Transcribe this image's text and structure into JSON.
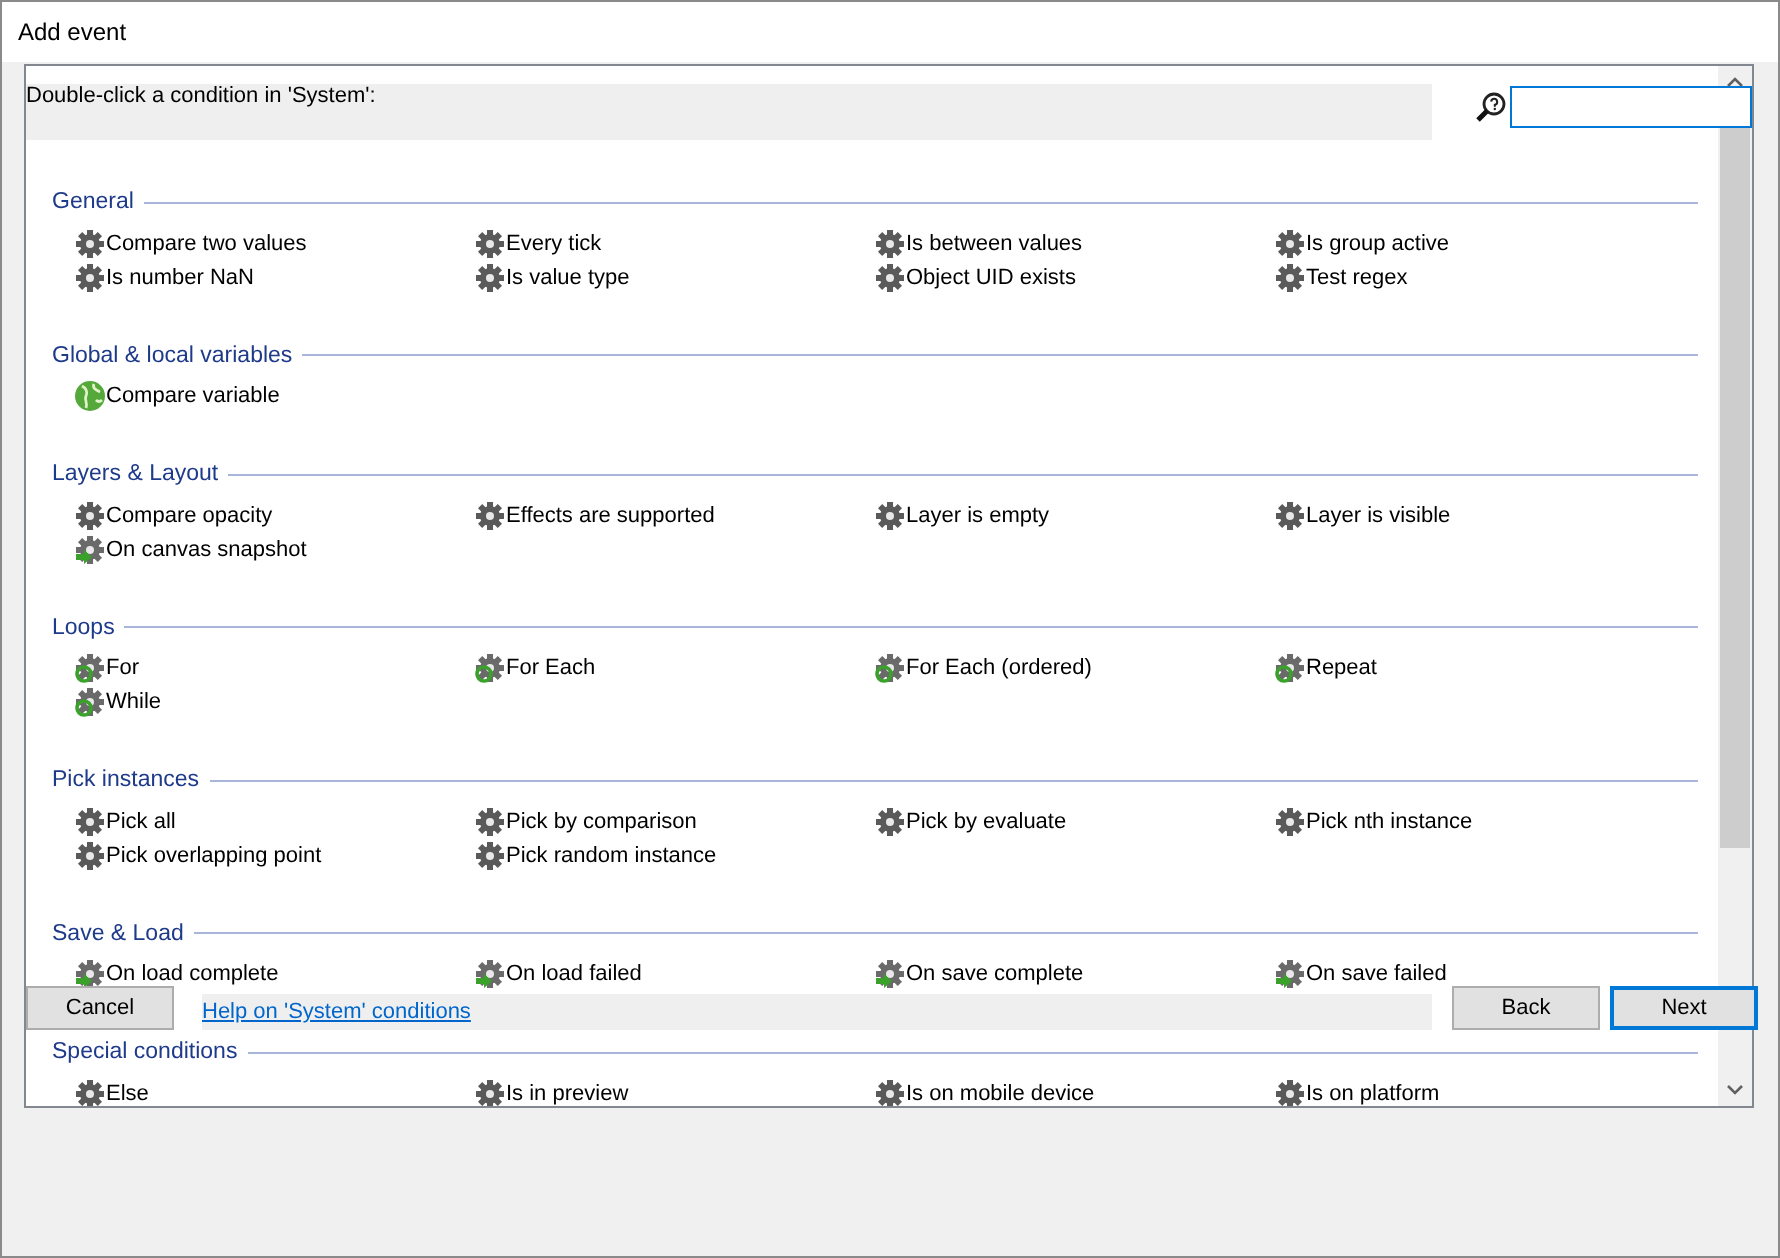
{
  "window": {
    "title": "Add event"
  },
  "header": {
    "prompt": "Double-click a condition in 'System':",
    "search": {
      "focused": true
    }
  },
  "sections": [
    {
      "title": "General",
      "items": [
        {
          "label": "Compare two values",
          "kind": "condition"
        },
        {
          "label": "Every tick",
          "kind": "condition"
        },
        {
          "label": "Is between values",
          "kind": "condition"
        },
        {
          "label": "Is group active",
          "kind": "condition"
        },
        {
          "label": "Is number NaN",
          "kind": "condition"
        },
        {
          "label": "Is value type",
          "kind": "condition"
        },
        {
          "label": "Object UID exists",
          "kind": "condition"
        },
        {
          "label": "Test regex",
          "kind": "condition"
        }
      ]
    },
    {
      "title": "Global & local variables",
      "items": [
        {
          "label": "Compare variable",
          "kind": "variable"
        }
      ]
    },
    {
      "title": "Layers & Layout",
      "items": [
        {
          "label": "Compare opacity",
          "kind": "condition"
        },
        {
          "label": "Effects are supported",
          "kind": "condition"
        },
        {
          "label": "Layer is empty",
          "kind": "condition"
        },
        {
          "label": "Layer is visible",
          "kind": "condition"
        },
        {
          "label": "On canvas snapshot",
          "kind": "trigger"
        }
      ]
    },
    {
      "title": "Loops",
      "items": [
        {
          "label": "For",
          "kind": "loop"
        },
        {
          "label": "For Each",
          "kind": "loop"
        },
        {
          "label": "For Each (ordered)",
          "kind": "loop"
        },
        {
          "label": "Repeat",
          "kind": "loop"
        },
        {
          "label": "While",
          "kind": "loop"
        }
      ]
    },
    {
      "title": "Pick instances",
      "items": [
        {
          "label": "Pick all",
          "kind": "condition"
        },
        {
          "label": "Pick by comparison",
          "kind": "condition"
        },
        {
          "label": "Pick by evaluate",
          "kind": "condition"
        },
        {
          "label": "Pick nth instance",
          "kind": "condition"
        },
        {
          "label": "Pick overlapping point",
          "kind": "condition"
        },
        {
          "label": "Pick random instance",
          "kind": "condition"
        }
      ]
    },
    {
      "title": "Save & Load",
      "items": [
        {
          "label": "On load complete",
          "kind": "trigger"
        },
        {
          "label": "On load failed",
          "kind": "trigger"
        },
        {
          "label": "On save complete",
          "kind": "trigger"
        },
        {
          "label": "On save failed",
          "kind": "trigger"
        }
      ]
    },
    {
      "title": "Special conditions",
      "items": [
        {
          "label": "Else",
          "kind": "condition"
        },
        {
          "label": "Is in preview",
          "kind": "condition"
        },
        {
          "label": "Is on mobile device",
          "kind": "condition"
        },
        {
          "label": "Is on platform",
          "kind": "condition"
        }
      ]
    }
  ],
  "footer": {
    "cancel": "Cancel",
    "help_link": "Help on 'System' conditions",
    "back": "Back",
    "next": {
      "label": "Next",
      "default": true
    }
  }
}
